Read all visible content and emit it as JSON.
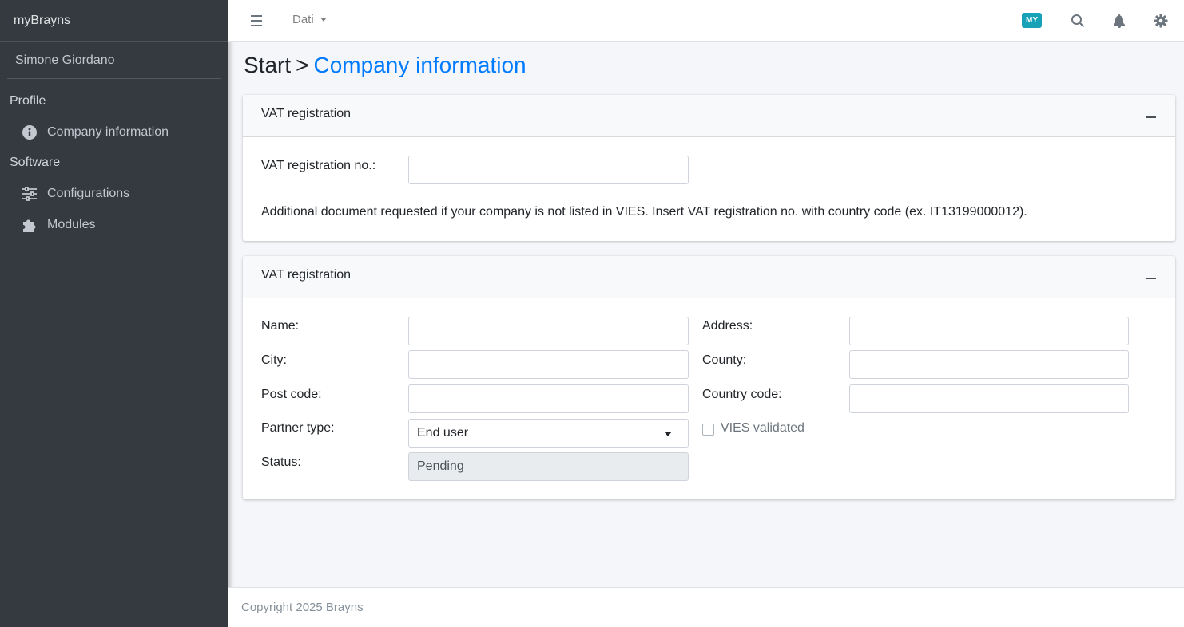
{
  "sidebar": {
    "brand": "myBrayns",
    "user_name": "Simone Giordano",
    "sections": [
      {
        "header": "Profile",
        "items": [
          {
            "label": "Company information",
            "icon": "info-circle-icon"
          }
        ]
      },
      {
        "header": "Software",
        "items": [
          {
            "label": "Configurations",
            "icon": "sliders-icon"
          },
          {
            "label": "Modules",
            "icon": "puzzle-icon"
          }
        ]
      }
    ]
  },
  "topbar": {
    "menu_icon": "hamburger-icon",
    "dropdown_label": "Dati",
    "badge": "MY",
    "badge_color": "#17a2b8",
    "icons": [
      "search-icon",
      "bell-icon",
      "gear-icon"
    ]
  },
  "breadcrumb": {
    "root": "Start",
    "separator": ">",
    "current": "Company information"
  },
  "vat_card": {
    "title": "VAT registration",
    "vat_label": "VAT registration no.:",
    "vat_value": "",
    "help_text": "Additional document requested if your company is not listed in VIES. Insert VAT registration no. with country code (ex. IT13199000012)."
  },
  "company_card": {
    "title": "VAT registration",
    "fields": {
      "name": {
        "label": "Name:",
        "value": ""
      },
      "city": {
        "label": "City:",
        "value": ""
      },
      "post_code": {
        "label": "Post code:",
        "value": ""
      },
      "partner_type": {
        "label": "Partner type:",
        "value": "End user"
      },
      "status": {
        "label": "Status:",
        "value": "Pending"
      },
      "address": {
        "label": "Address:",
        "value": ""
      },
      "county": {
        "label": "County:",
        "value": ""
      },
      "country_code": {
        "label": "Country code:",
        "value": ""
      }
    },
    "vies_label": "VIES validated",
    "vies_checked": false
  },
  "footer": {
    "copyright": "Copyright 2025 Brayns"
  },
  "colors": {
    "sidebar_bg": "#343a40",
    "accent": "#007bff"
  }
}
